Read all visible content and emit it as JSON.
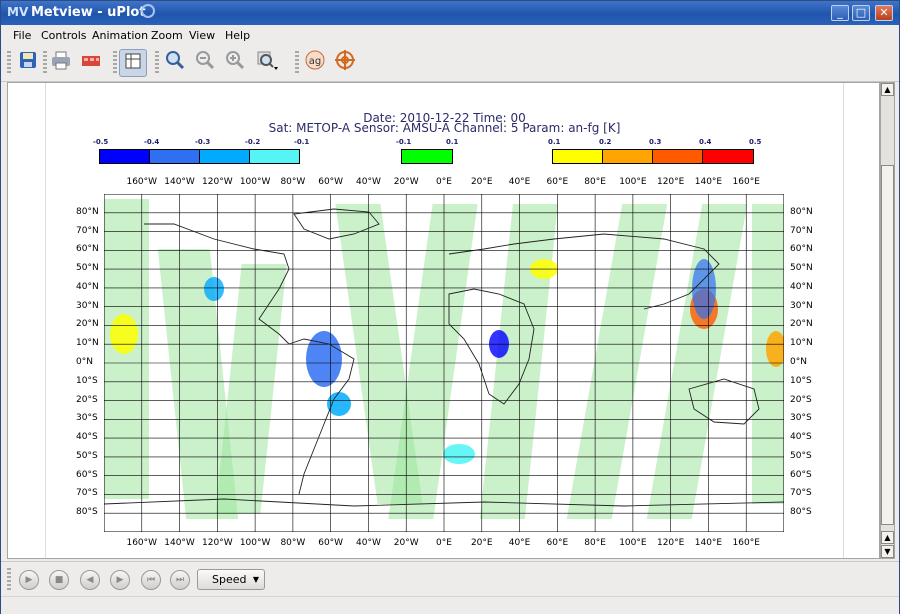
{
  "window": {
    "title": "Metview - uPlot",
    "icon_text": "MV",
    "buttons": {
      "minimize": "_",
      "maximize": "□",
      "close": "✕"
    }
  },
  "menu": [
    "File",
    "Controls",
    "Animation",
    "Zoom",
    "View",
    "Help"
  ],
  "toolbar": {
    "icons": [
      "save-icon",
      "print-icon",
      "export-icon",
      "layout-icon",
      "zoom-icon",
      "zoom-out-icon",
      "zoom-in-icon",
      "zoom-stack-icon",
      "antialias-icon",
      "cursor-data-icon"
    ],
    "antialias_text": "ag"
  },
  "plot": {
    "title_line1": "Date: 2010-12-22 Time: 00",
    "title_line2": "Sat: METOP-A  Sensor: AMSU-A  Channel: 5 Param: an-fg [K]",
    "title_color": "#2b2b6b"
  },
  "legend": {
    "negative": {
      "labels": [
        "-0.5",
        "-0.4",
        "-0.3",
        "-0.2",
        "-0.1"
      ],
      "colors": [
        "#0000ff",
        "#2f6ff2",
        "#00aaff",
        "#55f5f5"
      ]
    },
    "neutral": {
      "labels": [
        "-0.1",
        "0.1"
      ],
      "colors": [
        "#00ff00"
      ]
    },
    "positive": {
      "labels": [
        "0.1",
        "0.2",
        "0.3",
        "0.4",
        "0.5"
      ],
      "colors": [
        "#ffff00",
        "#ffa500",
        "#ff5a00",
        "#ff0000"
      ]
    }
  },
  "map": {
    "lon_labels": [
      "160°W",
      "140°W",
      "120°W",
      "100°W",
      "80°W",
      "60°W",
      "40°W",
      "20°W",
      "0°E",
      "20°E",
      "40°E",
      "60°E",
      "80°E",
      "100°E",
      "120°E",
      "140°E",
      "160°E"
    ],
    "lat_labels": [
      "80°N",
      "70°N",
      "60°N",
      "50°N",
      "40°N",
      "30°N",
      "20°N",
      "10°N",
      "0°N",
      "10°S",
      "20°S",
      "30°S",
      "40°S",
      "50°S",
      "60°S",
      "70°S",
      "80°S"
    ]
  },
  "playback": {
    "buttons": [
      "play-icon",
      "stop-icon",
      "previous-icon",
      "next-icon",
      "first-icon",
      "last-icon"
    ],
    "speed_label": "Speed"
  }
}
